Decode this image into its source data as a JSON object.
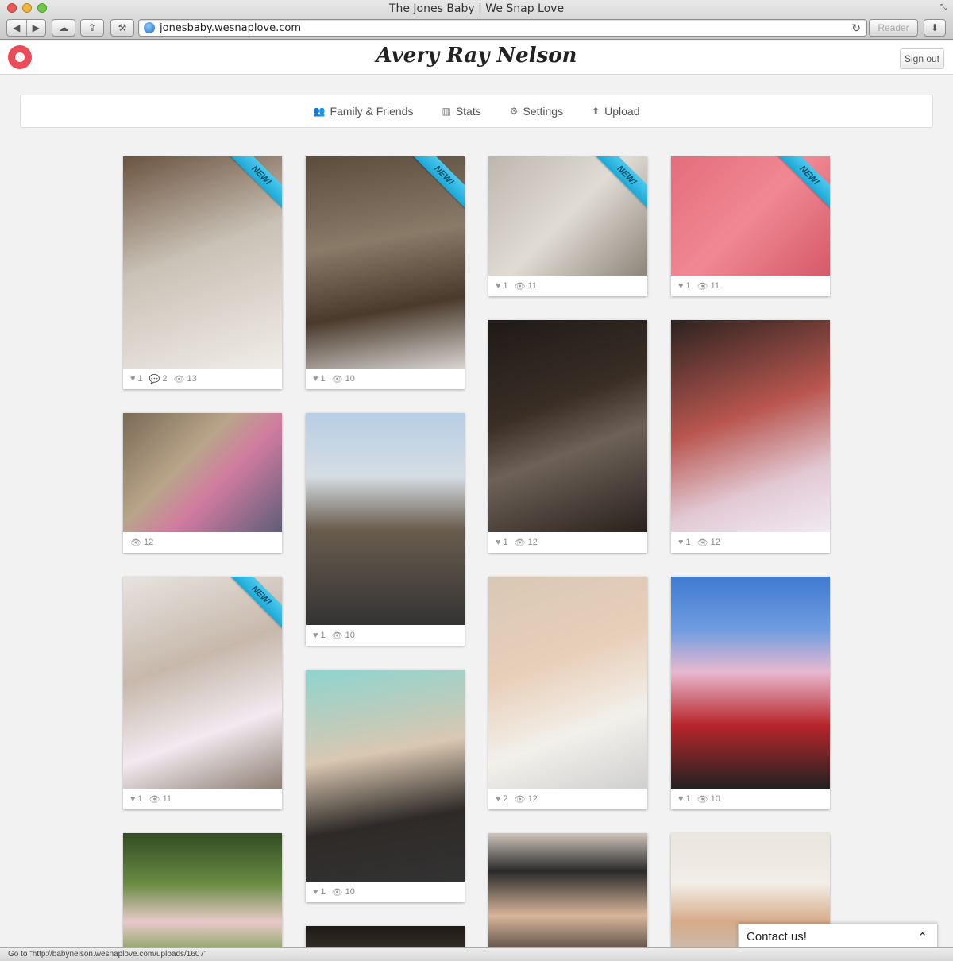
{
  "window": {
    "title": "The Jones Baby | We Snap Love",
    "url": "jonesbaby.wesnaplove.com",
    "reader_label": "Reader"
  },
  "header": {
    "brand": "Avery Ray Nelson",
    "sign_out": "Sign out"
  },
  "nav": [
    {
      "label": "Family & Friends",
      "icon": "people-icon"
    },
    {
      "label": "Stats",
      "icon": "chart-icon"
    },
    {
      "label": "Settings",
      "icon": "gear-icon"
    },
    {
      "label": "Upload",
      "icon": "upload-arrow-icon"
    }
  ],
  "new_badge": "NEW!",
  "photos": [
    {
      "likes": "1",
      "comments": "2",
      "views": "13",
      "is_new": true
    },
    {
      "likes": "1",
      "views": "10",
      "is_new": true
    },
    {
      "likes": "1",
      "views": "11",
      "is_new": true
    },
    {
      "likes": "1",
      "views": "11",
      "is_new": true
    },
    {
      "views": "12"
    },
    {
      "likes": "1",
      "views": "10"
    },
    {
      "likes": "1",
      "views": "12"
    },
    {
      "likes": "1",
      "views": "12"
    },
    {
      "likes": "1",
      "views": "11",
      "is_new": true
    },
    {
      "likes": "1",
      "views": "10"
    },
    {
      "likes": "2",
      "views": "12"
    },
    {
      "likes": "1",
      "views": "10"
    },
    {},
    {},
    {},
    {}
  ],
  "status_bar": "Go to \"http://babynelson.wesnaplove.com/uploads/1607\"",
  "contact": {
    "label": "Contact us!"
  },
  "colors": {
    "accent": "#ea4d57",
    "ribbon": "#2bb6e0"
  }
}
